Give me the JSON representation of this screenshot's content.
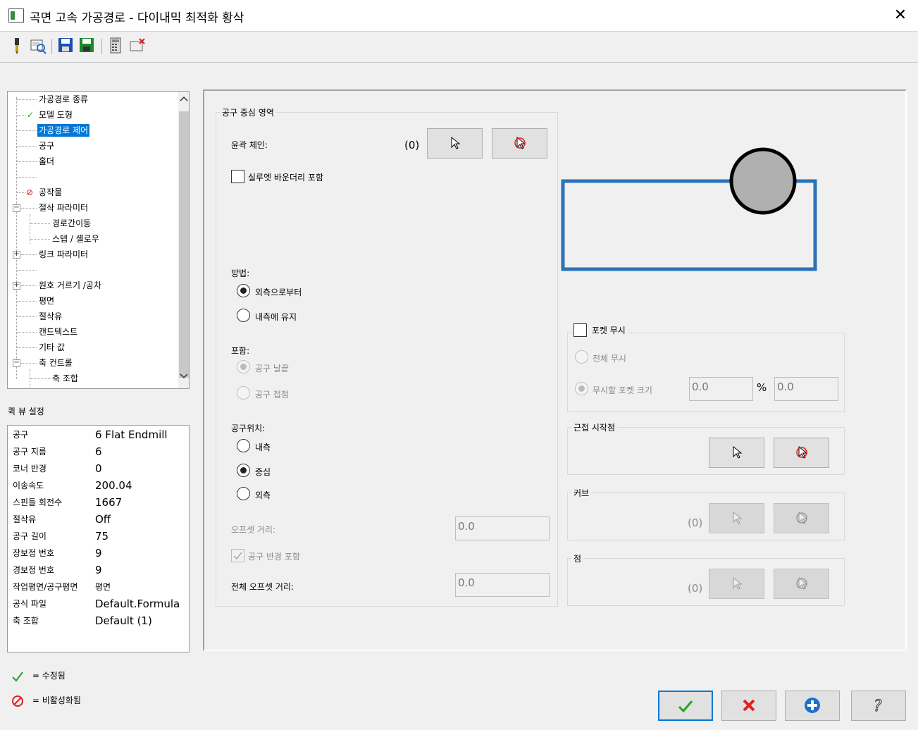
{
  "window": {
    "title": "곡면 고속 가공경로 - 다이내믹 최적화 황삭",
    "close": "✕"
  },
  "tree": {
    "items": [
      {
        "label": "가공경로 종류"
      },
      {
        "label": "모델 도형",
        "mark": "✓"
      },
      {
        "label": "가공경로 제어"
      },
      {
        "label": "공구"
      },
      {
        "label": "홀더"
      },
      {
        "label": ""
      },
      {
        "label": "공작물",
        "mark": "⊘"
      },
      {
        "label": "절삭 파라미터",
        "expander": "−"
      },
      {
        "label": "경로간이동"
      },
      {
        "label": "스텝 / 셸로우"
      },
      {
        "label": "링크 파라미터",
        "expander": "+"
      },
      {
        "label": ""
      },
      {
        "label": "원호 거르기 /공차",
        "expander": "+"
      },
      {
        "label": "평면"
      },
      {
        "label": "절삭유"
      },
      {
        "label": "캔드텍스트"
      },
      {
        "label": "기타 값"
      },
      {
        "label": "축 컨트롤",
        "expander": "−"
      },
      {
        "label": "축 조합"
      }
    ]
  },
  "quickview": {
    "label": "퀵 뷰 설정",
    "rows": [
      {
        "k": "공구",
        "v": "6 Flat Endmill"
      },
      {
        "k": "공구 지름",
        "v": "6"
      },
      {
        "k": "코너 반경",
        "v": "0"
      },
      {
        "k": "이송속도",
        "v": "200.04"
      },
      {
        "k": "스핀들 회전수",
        "v": "1667"
      },
      {
        "k": "절삭유",
        "v": "Off"
      },
      {
        "k": "공구 길이",
        "v": "75"
      },
      {
        "k": "장보정 번호",
        "v": "9"
      },
      {
        "k": "경보정 번호",
        "v": "9"
      },
      {
        "k": "작업평면/공구평면",
        "v": "평면"
      },
      {
        "k": "공식 파일",
        "v": "Default.Formula"
      },
      {
        "k": "축 조합",
        "v": "Default (1)"
      }
    ]
  },
  "legend": {
    "modified": "= 수정됨",
    "disabled": "= 비활성화됨"
  },
  "main": {
    "containment_group": "공구 중심 영역",
    "chain_label": "윤곽 체인:",
    "chain_count": "(0)",
    "silhouette": "실루엣 바운더리 포함",
    "method_label": "방법:",
    "method_outside": "외측으로부터",
    "method_stay": "내측에 유지",
    "include_label": "포함:",
    "include_flute": "공구 날끝",
    "include_contact": "공구 접점",
    "toolpos_label": "공구위치:",
    "toolpos_inside": "내측",
    "toolpos_center": "중심",
    "toolpos_outside": "외측",
    "offset_label": "오프셋 거리:",
    "offset_value": "0.0",
    "include_radius": "공구 반경 포함",
    "total_offset_label": "전체 오프셋 거리:",
    "total_offset_value": "0.0",
    "pocket_label": "포켓 무시",
    "pocket_all": "전체 무시",
    "pocket_size": "무시할 포켓 크기",
    "pocket_val1": "0.0",
    "pocket_pct": "%",
    "pocket_val2": "0.0",
    "approach_label": "근접 시작점",
    "curve_label": "커브",
    "curve_count": "(0)",
    "point_label": "점",
    "point_count": "(0)"
  },
  "colors": {
    "preview_blue": "#2a72b8",
    "tool_gray": "#b0b0b0",
    "check_green": "#2aa02a",
    "cancel_red": "#e02020",
    "plus_blue": "#1a6fd0"
  }
}
